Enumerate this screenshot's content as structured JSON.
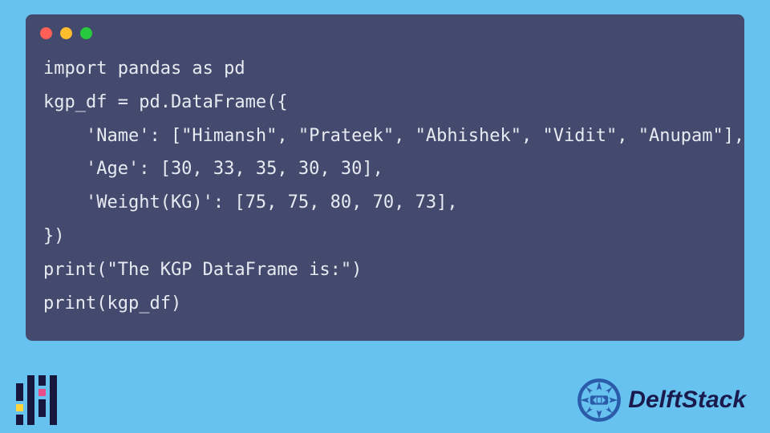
{
  "code": {
    "lines": [
      "import pandas as pd",
      "",
      "kgp_df = pd.DataFrame({",
      "    'Name': [\"Himansh\", \"Prateek\", \"Abhishek\", \"Vidit\", \"Anupam\"],",
      "    'Age': [30, 33, 35, 30, 30],",
      "    'Weight(KG)': [75, 75, 80, 70, 73],",
      "})",
      "print(\"The KGP DataFrame is:\")",
      "print(kgp_df)"
    ]
  },
  "brand": {
    "name": "DelftStack"
  },
  "window": {
    "dots": [
      "red",
      "yellow",
      "green"
    ]
  }
}
